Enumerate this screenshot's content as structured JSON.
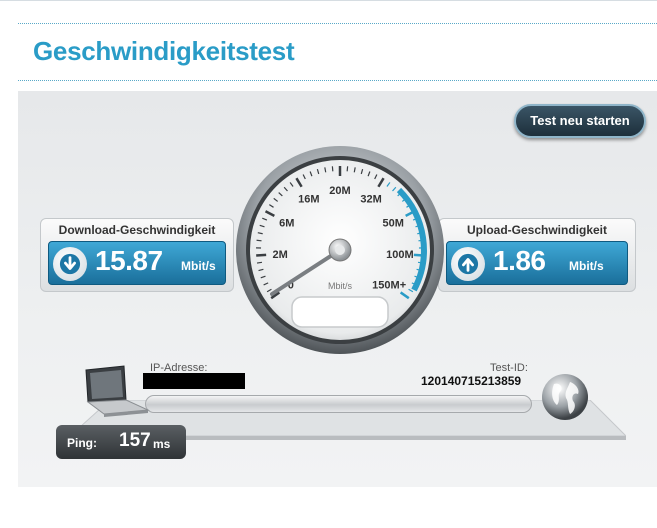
{
  "page": {
    "title": "Geschwindigkeitstest"
  },
  "toolbar": {
    "restart_label": "Test neu starten"
  },
  "download": {
    "label": "Download-Geschwindigkeit",
    "value": "15.87",
    "unit": "Mbit/s",
    "icon": "arrow-down-icon"
  },
  "upload": {
    "label": "Upload-Geschwindigkeit",
    "value": "1.86",
    "unit": "Mbit/s",
    "icon": "arrow-up-icon"
  },
  "gauge": {
    "unit": "Mbit/s",
    "ticks": [
      "0",
      "2M",
      "6M",
      "16M",
      "20M",
      "32M",
      "50M",
      "100M",
      "150M+"
    ],
    "needle_value_mbit": 0,
    "accent": "#2a9cc7"
  },
  "connection": {
    "ip_label": "IP-Adresse:",
    "test_id_label": "Test-ID:",
    "test_id_value": "120140715213859"
  },
  "ping": {
    "label": "Ping:",
    "value": "157",
    "unit": "ms"
  },
  "colors": {
    "title": "#2a9cc7",
    "speed_bar": "#2a88b8",
    "button": "#2b4252"
  }
}
